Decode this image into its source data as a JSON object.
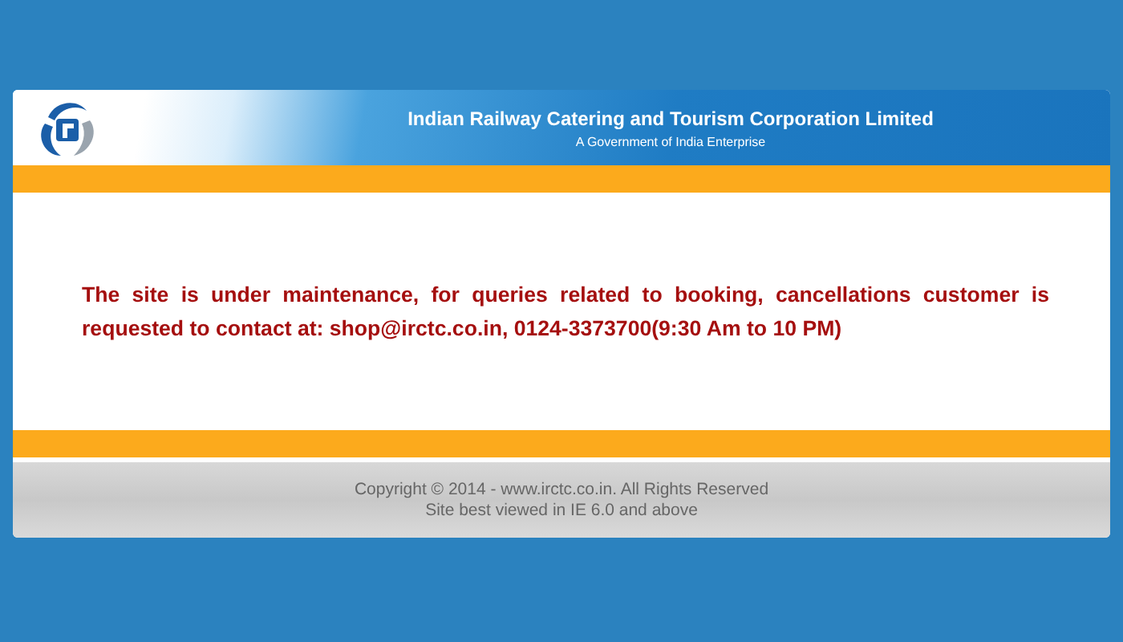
{
  "header": {
    "title": "Indian Railway Catering and Tourism Corporation Limited",
    "subtitle": "A Government of India Enterprise"
  },
  "message": "The site is under maintenance, for queries related to booking, cancellations customer is requested to contact at: shop@irctc.co.in, 0124-3373700(9:30 Am to 10 PM)",
  "footer": {
    "copyright": "Copyright © 2014 - www.irctc.co.in. All Rights Reserved",
    "note": "Site best viewed in IE 6.0 and above"
  }
}
